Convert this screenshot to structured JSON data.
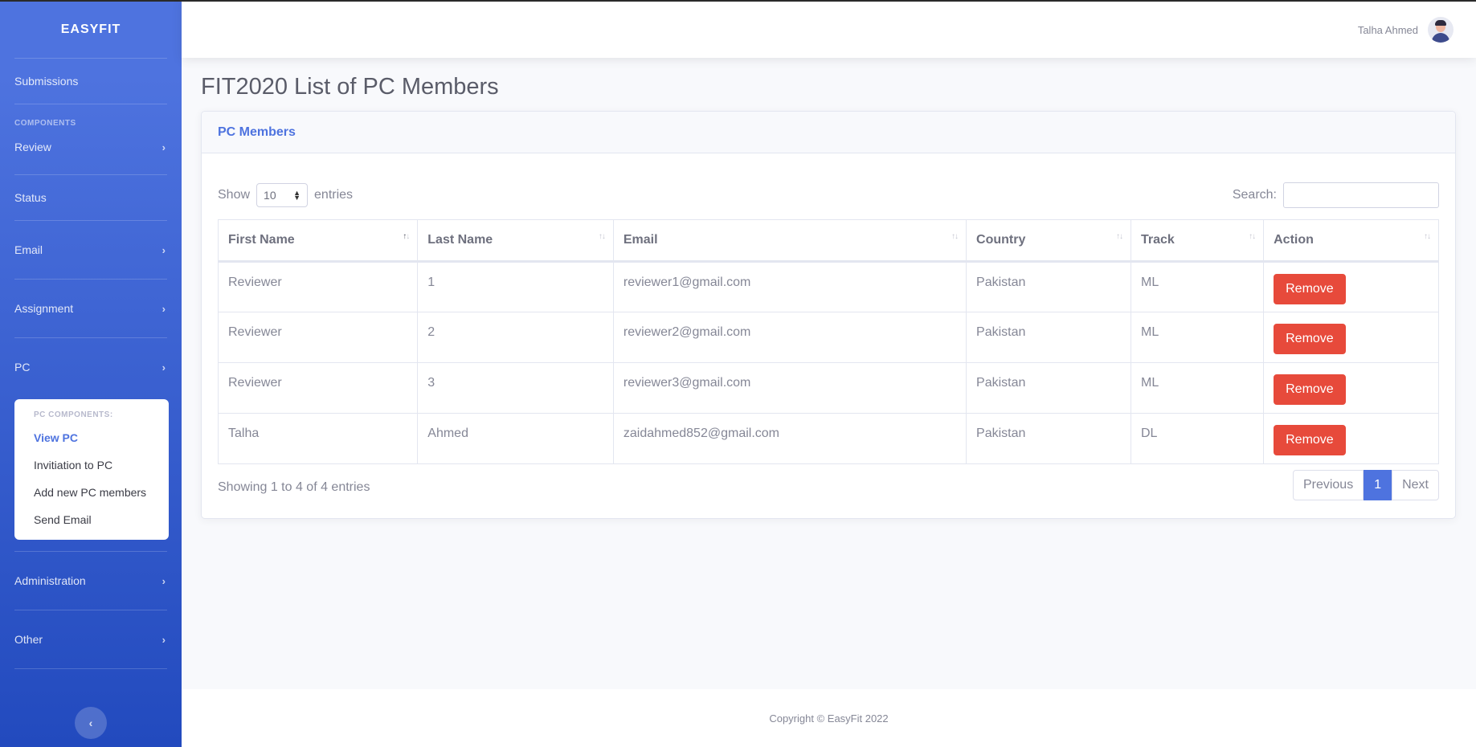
{
  "sidebar": {
    "brand": "EASYFIT",
    "items": [
      {
        "label": "Submissions"
      },
      {
        "label": "Review"
      },
      {
        "label": "Status"
      },
      {
        "label": "Email"
      },
      {
        "label": "Assignment"
      },
      {
        "label": "PC"
      },
      {
        "label": "Administration"
      },
      {
        "label": "Other"
      }
    ],
    "heading_components": "COMPONENTS",
    "pc_submenu": {
      "header": "PC COMPONENTS:",
      "items": [
        "View PC",
        "Invitiation to PC",
        "Add new PC members",
        "Send Email"
      ]
    },
    "collapse_icon": "chevron-left-icon"
  },
  "topbar": {
    "username": "Talha Ahmed"
  },
  "page": {
    "title": "FIT2020 List of PC Members"
  },
  "card": {
    "header": "PC Members",
    "show_label": "Show",
    "entries_label": "entries",
    "page_length": "10",
    "search_label": "Search:",
    "search_value": "",
    "columns": [
      "First Name",
      "Last Name",
      "Email",
      "Country",
      "Track",
      "Action"
    ],
    "rows": [
      {
        "first": "Reviewer",
        "last": "1",
        "email": "reviewer1@gmail.com",
        "country": "Pakistan",
        "track": "ML",
        "action": "Remove"
      },
      {
        "first": "Reviewer",
        "last": "2",
        "email": "reviewer2@gmail.com",
        "country": "Pakistan",
        "track": "ML",
        "action": "Remove"
      },
      {
        "first": "Reviewer",
        "last": "3",
        "email": "reviewer3@gmail.com",
        "country": "Pakistan",
        "track": "ML",
        "action": "Remove"
      },
      {
        "first": "Talha",
        "last": "Ahmed",
        "email": "zaidahmed852@gmail.com",
        "country": "Pakistan",
        "track": "DL",
        "action": "Remove"
      }
    ],
    "info": "Showing 1 to 4 of 4 entries",
    "pagination": {
      "previous": "Previous",
      "current": "1",
      "next": "Next"
    }
  },
  "footer": {
    "copyright": "Copyright © EasyFit 2022"
  },
  "colors": {
    "primary": "#4e73df",
    "danger": "#e74a3b",
    "sidebar_gradient_start": "#4e73df",
    "sidebar_gradient_end": "#224abe"
  }
}
